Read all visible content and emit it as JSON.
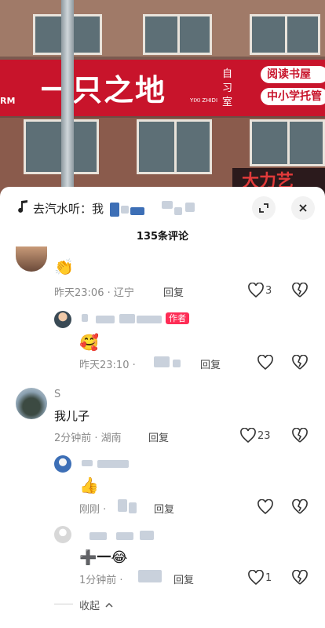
{
  "video": {
    "sign_main": "一只之地",
    "sign_side": "自习室",
    "sign_pinyin": "YIXI ZHIDI",
    "sign_left": "RM",
    "pill_1": "阅读书屋",
    "pill_2": "中小学托管",
    "lower_sign": "大力艺"
  },
  "topbar": {
    "music_text": "去汽水听：我",
    "comment_count": "135条评论"
  },
  "comments": [
    {
      "content": "👏",
      "time": "昨天23:06 · 辽宁",
      "reply_label": "回复",
      "likes": "3"
    },
    {
      "badge": "作者",
      "content": "🥰",
      "time": "昨天23:10 ·",
      "reply_label": "回复"
    },
    {
      "username": "S",
      "content": "我儿子",
      "time": "2分钟前 · 湖南",
      "reply_label": "回复",
      "likes": "23"
    },
    {
      "content": "👍",
      "time": "刚刚 · ",
      "reply_label": "回复"
    },
    {
      "content": "➕一😂",
      "time": "1分钟前 ·",
      "reply_label": "回复",
      "likes": "1"
    }
  ],
  "collapse_label": "收起",
  "colors": {
    "brand_red": "#c8142b",
    "author_badge": "#fe2c55"
  }
}
